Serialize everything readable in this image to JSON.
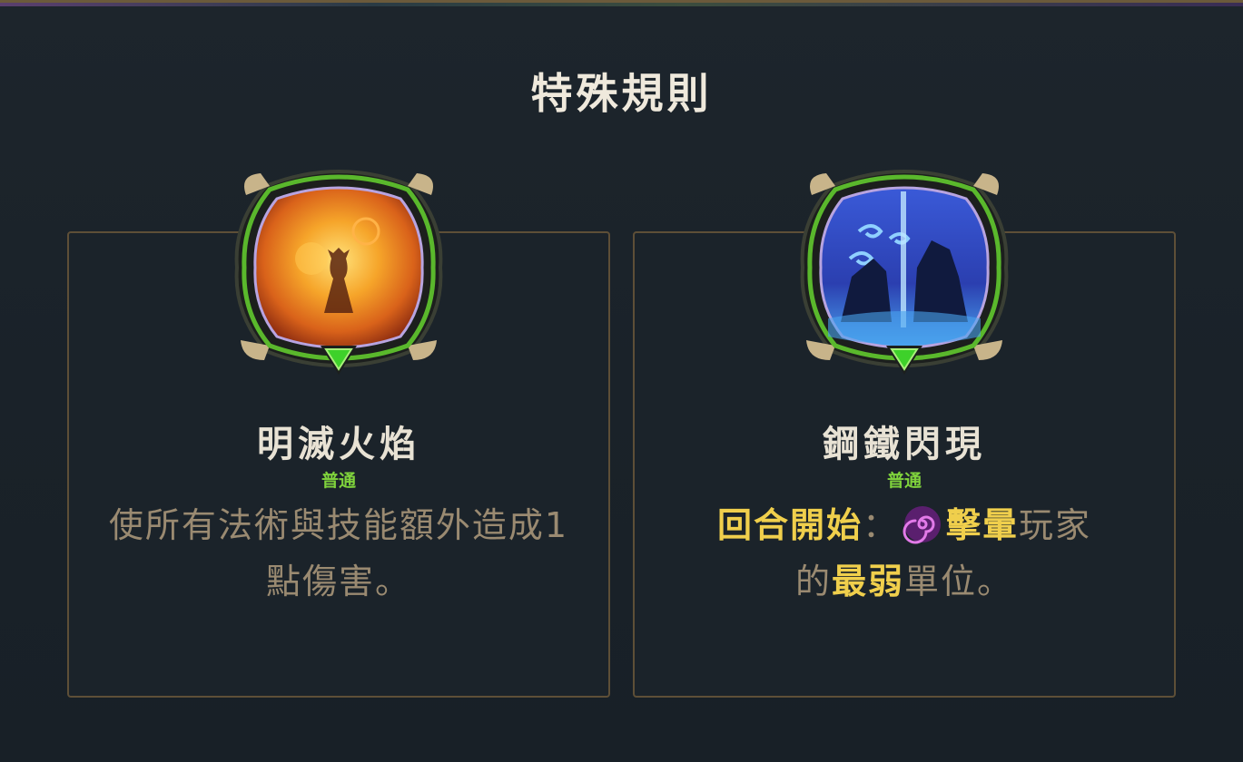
{
  "panel": {
    "title": "特殊規則"
  },
  "cards": [
    {
      "name": "明滅火焰",
      "rarity": "普通",
      "description": "使所有法術與技能額外造成1點傷害。",
      "icon": "fire-girl-icon"
    },
    {
      "name": "鋼鐵閃現",
      "rarity": "普通",
      "description_parts": {
        "trigger": "回合開始",
        "colon": "：",
        "keyword_stun": "擊暈",
        "text1": "玩家",
        "text2": "的",
        "keyword_weakest": "最弱",
        "text3": "單位。"
      },
      "icon": "steel-shadow-icon",
      "stun_icon": "spiral-stun-icon"
    }
  ],
  "colors": {
    "background": "#1a2128",
    "border": "#5e4f37",
    "title": "#efe9dc",
    "rarity": "#7fd23c",
    "description": "#9a8a71",
    "highlight": "#f0cf4c"
  }
}
